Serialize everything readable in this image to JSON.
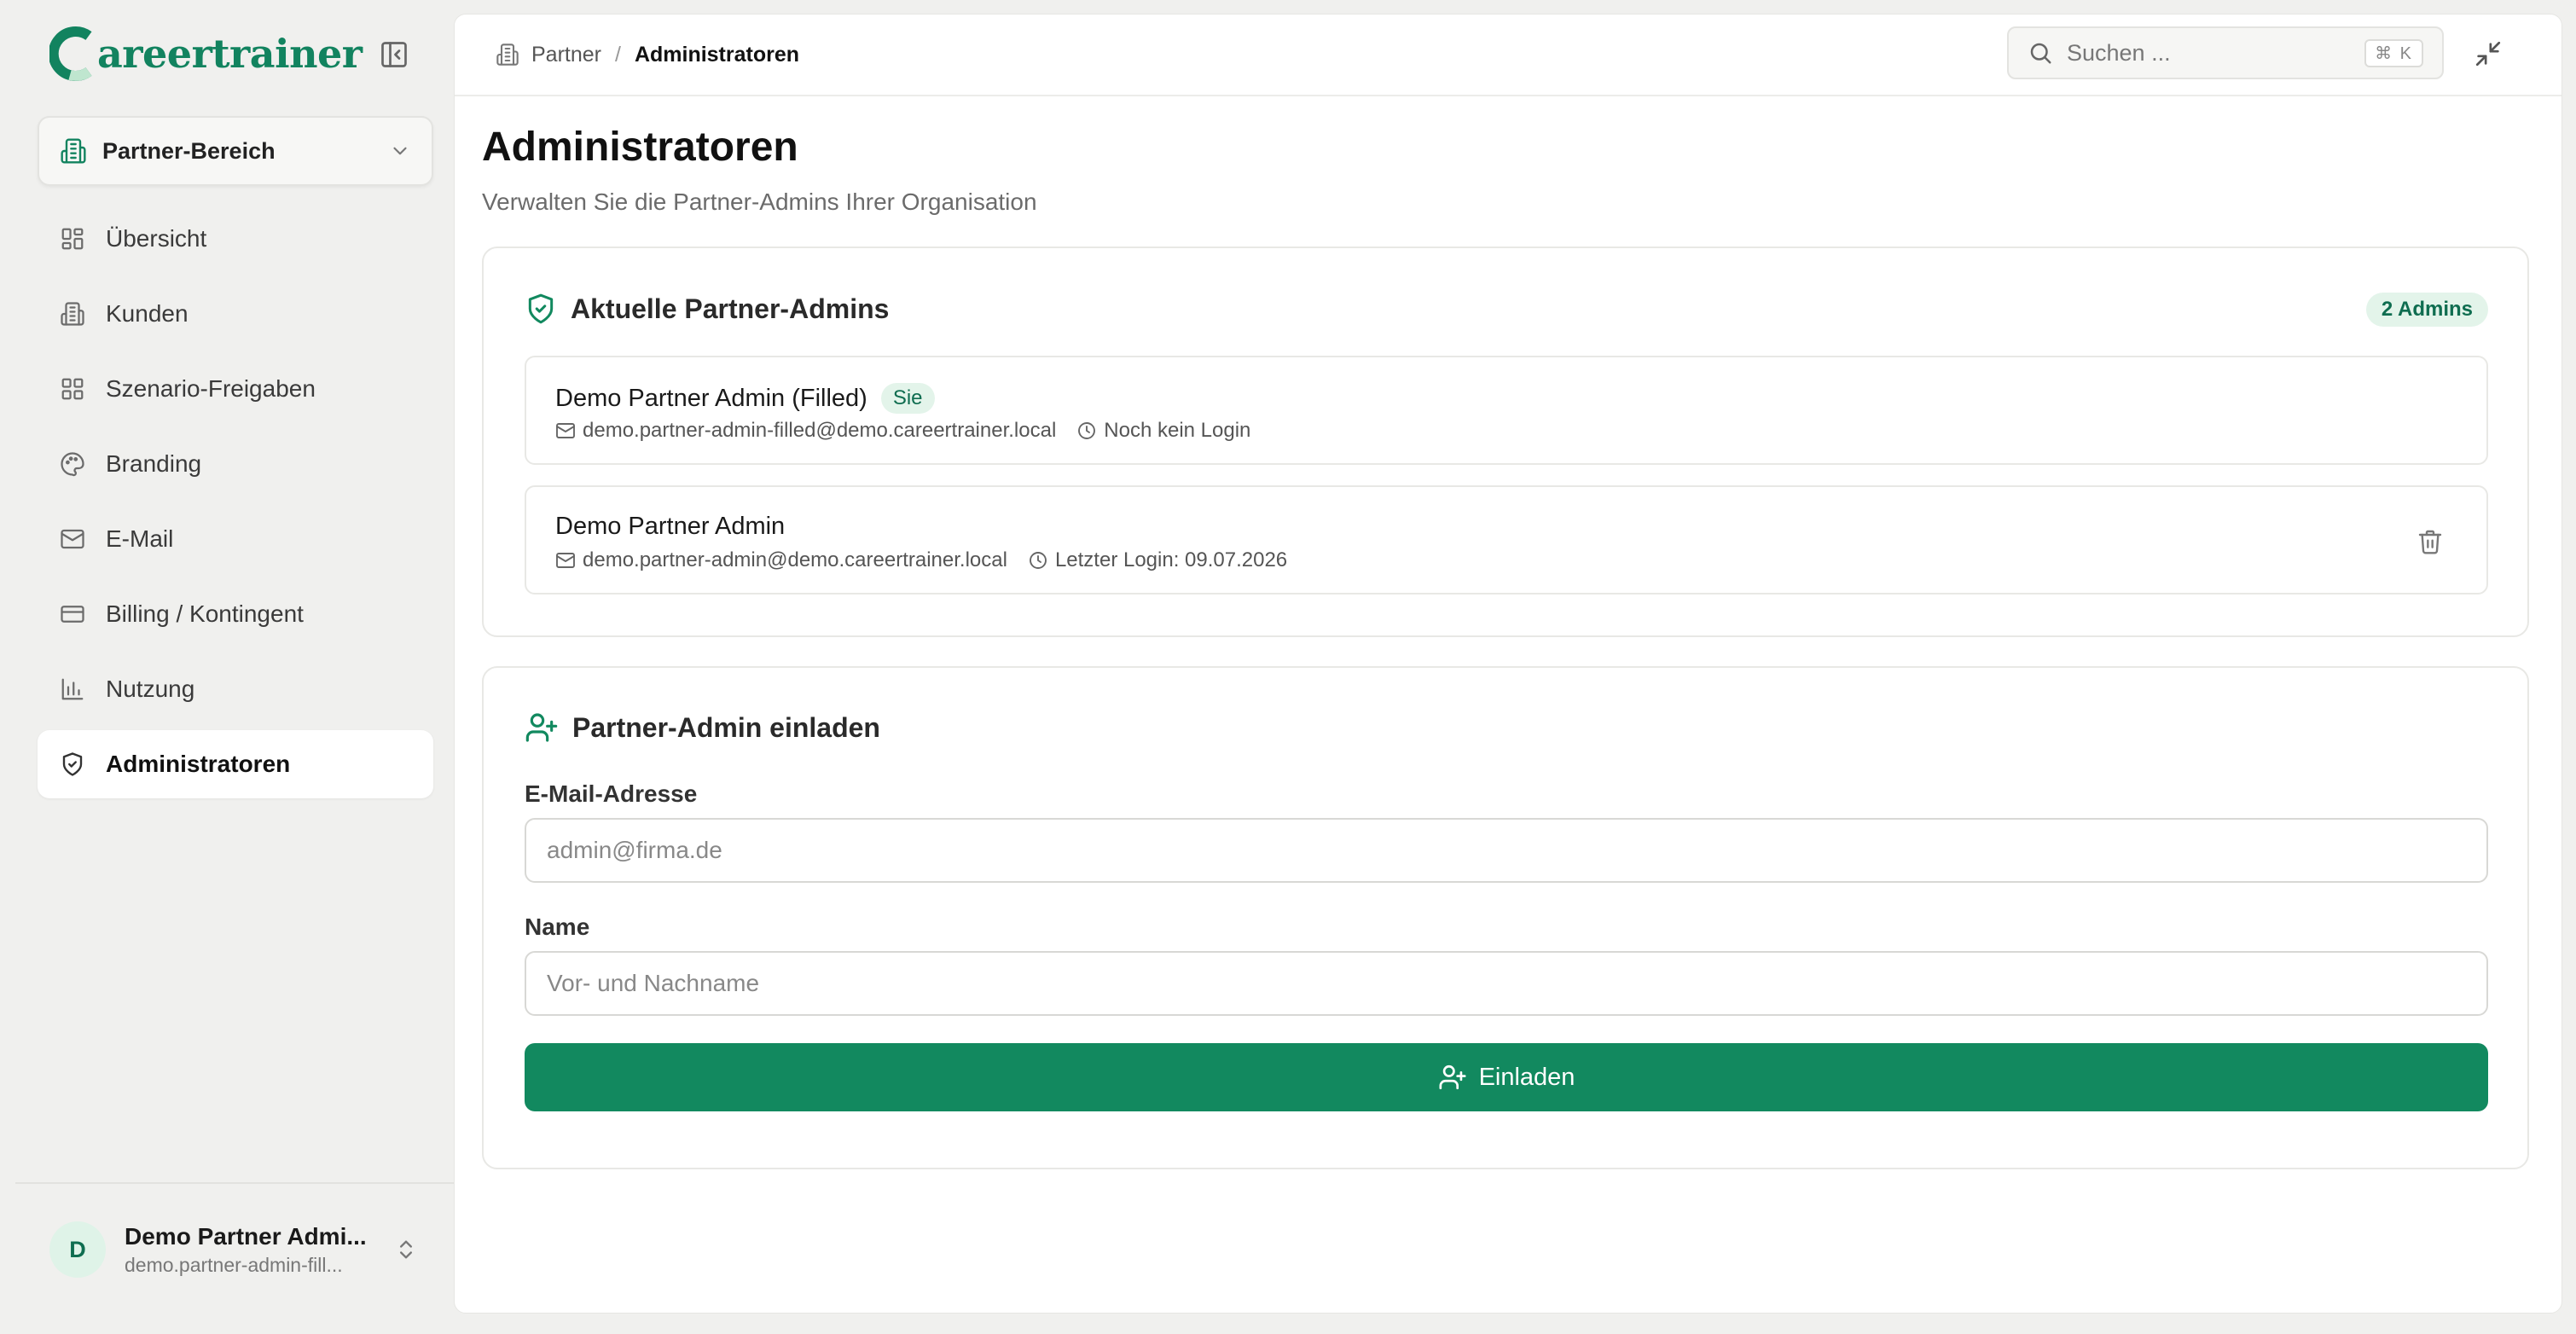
{
  "brand": {
    "name": "areertrainer",
    "accent": "#12895f"
  },
  "sidebar": {
    "area_label": "Partner-Bereich",
    "items": [
      {
        "label": "Übersicht",
        "icon": "layout-grid-icon"
      },
      {
        "label": "Kunden",
        "icon": "building-icon"
      },
      {
        "label": "Szenario-Freigaben",
        "icon": "layout-grid-icon"
      },
      {
        "label": "Branding",
        "icon": "palette-icon"
      },
      {
        "label": "E-Mail",
        "icon": "mail-icon"
      },
      {
        "label": "Billing / Kontingent",
        "icon": "credit-card-icon"
      },
      {
        "label": "Nutzung",
        "icon": "bar-chart-icon"
      },
      {
        "label": "Administratoren",
        "icon": "shield-check-icon",
        "active": true
      }
    ],
    "user": {
      "initial": "D",
      "name": "Demo Partner Admi...",
      "email": "demo.partner-admin-fill..."
    }
  },
  "header": {
    "breadcrumb_parent": "Partner",
    "breadcrumb_sep": "/",
    "breadcrumb_current": "Administratoren",
    "search_placeholder": "Suchen ...",
    "search_shortcut": "⌘ K"
  },
  "page": {
    "title": "Administratoren",
    "subtitle": "Verwalten Sie die Partner-Admins Ihrer Organisation"
  },
  "admins_card": {
    "title": "Aktuelle Partner-Admins",
    "count_badge": "2 Admins",
    "rows": [
      {
        "name": "Demo Partner Admin (Filled)",
        "badge": "Sie",
        "email": "demo.partner-admin-filled@demo.careertrainer.local",
        "login": "Noch kein Login"
      },
      {
        "name": "Demo Partner Admin",
        "email": "demo.partner-admin@demo.careertrainer.local",
        "login": "Letzter Login: 09.07.2026"
      }
    ]
  },
  "invite_card": {
    "title": "Partner-Admin einladen",
    "email_label": "E-Mail-Adresse",
    "email_placeholder": "admin@firma.de",
    "email_value": "",
    "name_label": "Name",
    "name_placeholder": "Vor- und Nachname",
    "name_value": "",
    "submit_label": "Einladen"
  }
}
